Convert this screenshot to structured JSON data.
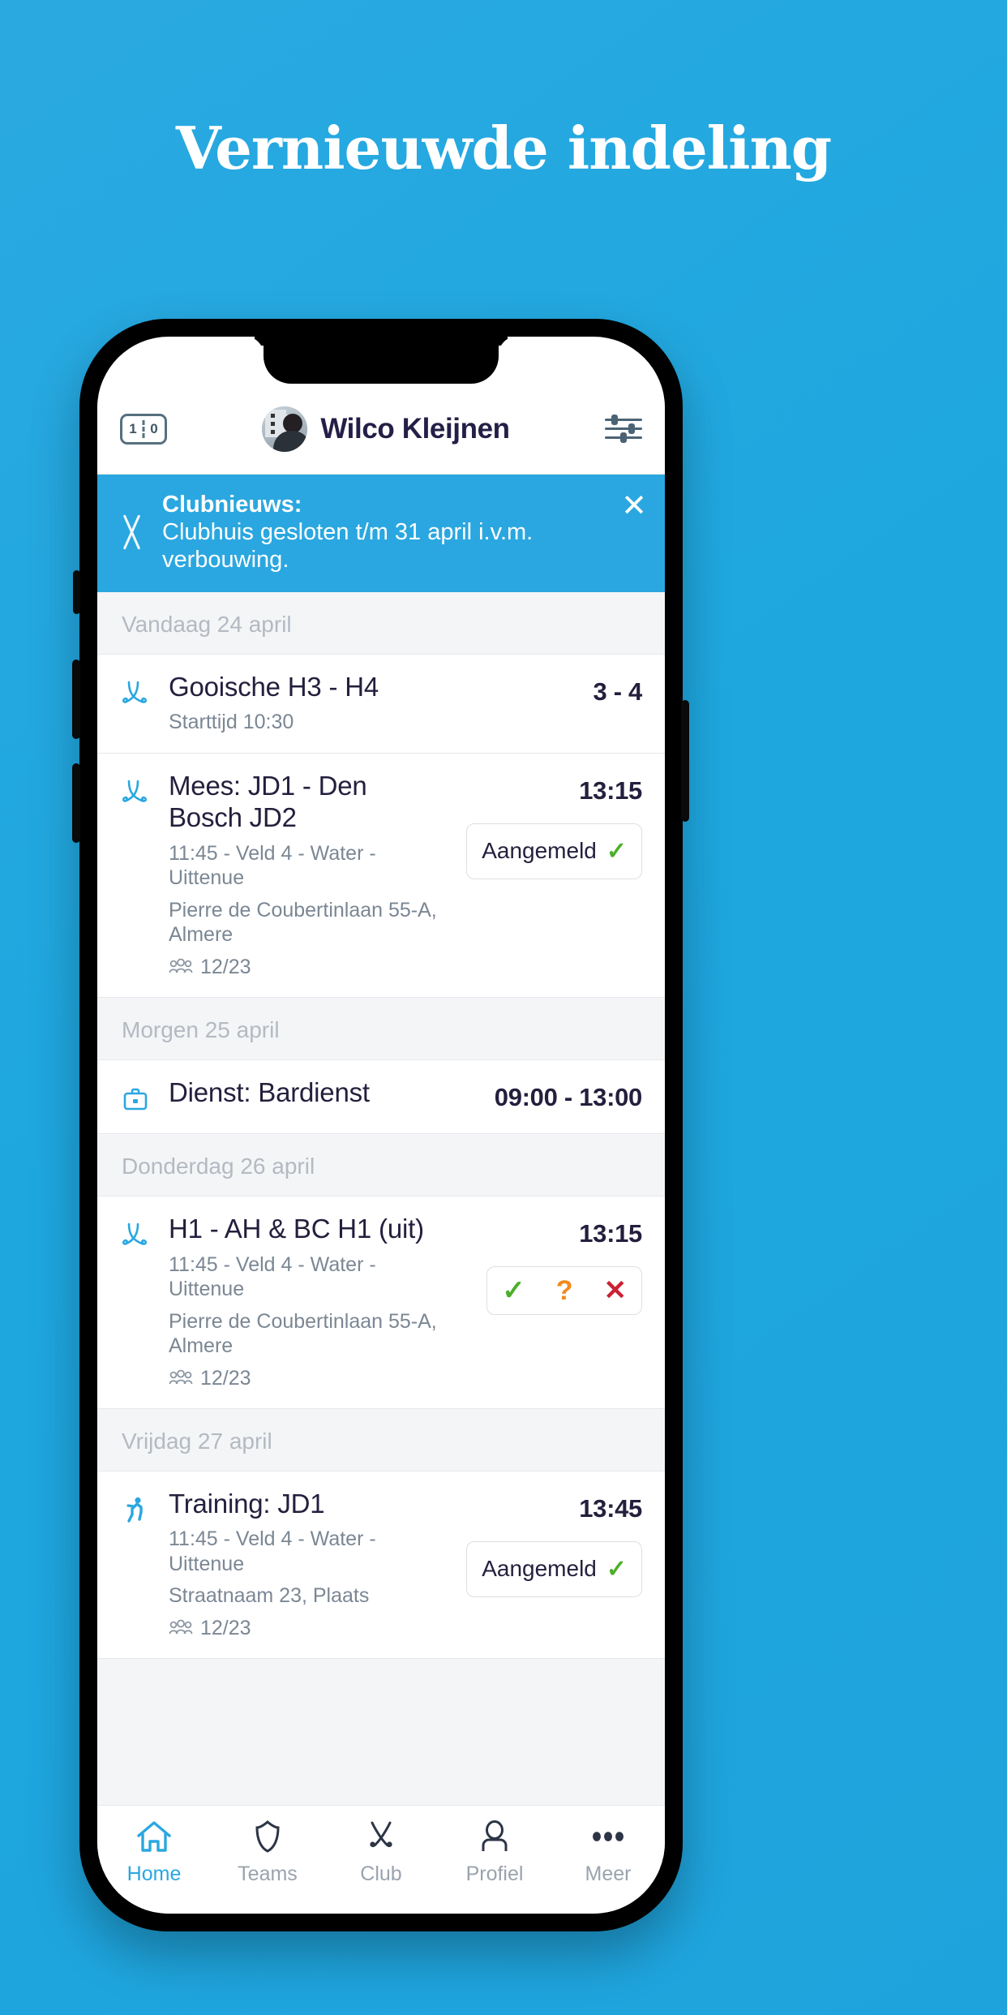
{
  "headline": "Vernieuwde indeling",
  "theme": {
    "background": "#1fa3dc",
    "accent": "#2aa7e0",
    "text_dark": "#231f3d",
    "text_muted": "#7b8794",
    "day_header": "#b4bac2",
    "green": "#4caf2a",
    "orange": "#f08a20",
    "red": "#cc2233"
  },
  "header": {
    "scoreboard_icon": "scoreboard-icon",
    "score_home": "1",
    "score_away": "0",
    "avatar_icon": "avatar",
    "user_name": "Wilco Kleijnen",
    "settings_icon": "sliders-icon"
  },
  "banner": {
    "icon": "crossed-sticks-icon",
    "title": "Clubnieuws:",
    "message": "Clubhuis gesloten t/m 31 april i.v.m. verbouwing.",
    "close_icon": "close-icon"
  },
  "agenda": [
    {
      "day_label": "Vandaag 24 april",
      "events": [
        {
          "icon": "hockey-sticks-icon",
          "title": "Gooische H3 - H4",
          "lines": [
            "Starttijd 10:30"
          ],
          "people": null,
          "right_value": "3 - 4",
          "action": null
        },
        {
          "icon": "hockey-sticks-icon",
          "title": "Mees: JD1 - Den Bosch JD2",
          "lines": [
            "11:45 - Veld 4 - Water - Uittenue",
            "Pierre de Coubertinlaan 55-A, Almere"
          ],
          "people": "12/23",
          "right_value": "13:15",
          "action": {
            "type": "pill",
            "label": "Aangemeld",
            "state_icon": "check-icon"
          }
        }
      ]
    },
    {
      "day_label": "Morgen 25 april",
      "events": [
        {
          "icon": "briefcase-icon",
          "title": "Dienst: Bardienst",
          "lines": [],
          "people": null,
          "right_value": "09:00 - 13:00",
          "action": null
        }
      ]
    },
    {
      "day_label": "Donderdag 26 april",
      "events": [
        {
          "icon": "hockey-sticks-icon",
          "title": "H1 - AH & BC H1 (uit)",
          "lines": [
            "11:45 - Veld 4 - Water - Uittenue",
            "Pierre de Coubertinlaan 55-A, Almere"
          ],
          "people": "12/23",
          "right_value": "13:15",
          "action": {
            "type": "rsvp",
            "yes_icon": "check-icon",
            "yes_label": "✓",
            "maybe_label": "?",
            "no_label": "✕"
          }
        }
      ]
    },
    {
      "day_label": "Vrijdag 27 april",
      "events": [
        {
          "icon": "running-person-icon",
          "title": "Training: JD1",
          "lines": [
            "11:45 - Veld 4 - Water - Uittenue",
            "Straatnaam 23, Plaats"
          ],
          "people": "12/23",
          "right_value": "13:45",
          "action": {
            "type": "pill",
            "label": "Aangemeld",
            "state_icon": "check-icon"
          }
        }
      ]
    }
  ],
  "tabbar": [
    {
      "label": "Home",
      "icon": "home-icon",
      "active": true
    },
    {
      "label": "Teams",
      "icon": "shield-icon",
      "active": false
    },
    {
      "label": "Club",
      "icon": "crossed-sticks-icon",
      "active": false
    },
    {
      "label": "Profiel",
      "icon": "person-icon",
      "active": false
    },
    {
      "label": "Meer",
      "icon": "ellipsis-icon",
      "active": false
    }
  ]
}
